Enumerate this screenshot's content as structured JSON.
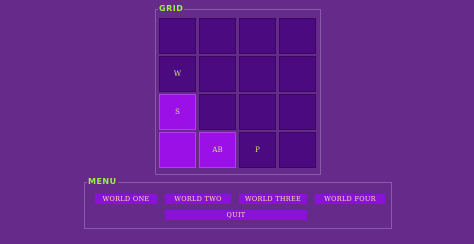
{
  "grid": {
    "legend": "GRID",
    "cells": [
      {
        "label": "",
        "lit": false
      },
      {
        "label": "",
        "lit": false
      },
      {
        "label": "",
        "lit": false
      },
      {
        "label": "",
        "lit": false
      },
      {
        "label": "W",
        "lit": false
      },
      {
        "label": "",
        "lit": false
      },
      {
        "label": "",
        "lit": false
      },
      {
        "label": "",
        "lit": false
      },
      {
        "label": "S",
        "lit": true
      },
      {
        "label": "",
        "lit": false
      },
      {
        "label": "",
        "lit": false
      },
      {
        "label": "",
        "lit": false
      },
      {
        "label": "",
        "lit": true
      },
      {
        "label": "AB",
        "lit": true
      },
      {
        "label": "P",
        "lit": false
      },
      {
        "label": "",
        "lit": false
      }
    ]
  },
  "menu": {
    "legend": "MENU",
    "world_one": "WORLD ONE",
    "world_two": "WORLD TWO",
    "world_three": "WORLD THREE",
    "world_four": "WORLD FOUR",
    "quit": "QUIT"
  },
  "colors": {
    "background": "#662a8a",
    "cell": "#4b0a80",
    "cell_lit": "#9a10e6",
    "button": "#8a10dc",
    "legend_text": "#9cf046",
    "cell_text": "#d7e27a"
  }
}
